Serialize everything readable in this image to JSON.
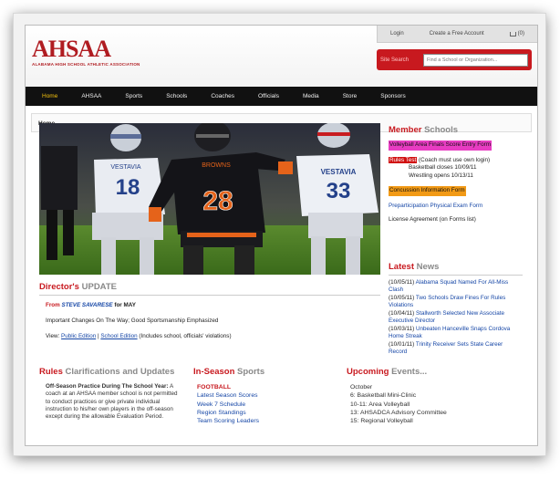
{
  "header": {
    "logo_text": "AHSAA",
    "logo_subtitle": "ALABAMA HIGH SCHOOL ATHLETIC ASSOCIATION",
    "login": "Login",
    "create_account": "Create a Free Account",
    "cart": "(0)",
    "search_label": "Site Search",
    "search_placeholder": "Find a School or Organization..."
  },
  "nav": [
    "Home",
    "AHSAA",
    "Sports",
    "Schools",
    "Coaches",
    "Officials",
    "Media",
    "Store",
    "Sponsors"
  ],
  "breadcrumb": "Home",
  "member": {
    "title_a": "Member",
    "title_b": "Schools",
    "volleyball": "Volleyball Area Finals Score Entry Form",
    "rules_test": "Rules Test",
    "rules_note": "(Coach must use own login)",
    "basketball_closes": "Basketball closes 10/09/11",
    "wrestling_opens": "Wrestling opens 10/13/11",
    "concussion": "Concussion Information Form",
    "preparticipation": "Preparticipation Physical Exam Form",
    "license": "License Agreement (on Forms list)"
  },
  "latest": {
    "title_a": "Latest",
    "title_b": "News",
    "items": [
      {
        "date": "(10/05/11)",
        "text": "Alabama Squad Named For All-Miss Clash"
      },
      {
        "date": "(10/05/11)",
        "text": "Two Schools Draw Fines For Rules Violations"
      },
      {
        "date": "(10/04/11)",
        "text": "Stallworth Selected New Associate Executive Director"
      },
      {
        "date": "(10/03/11)",
        "text": "Unbeaten Hanceville Snaps Cordova Home Streak"
      },
      {
        "date": "(10/01/11)",
        "text": "Trinity Receiver Sets State Career Record"
      }
    ]
  },
  "director": {
    "title_a": "Director's",
    "title_b": "UPDATE",
    "from": "From",
    "name": "STEVE SAVARESE",
    "for_may": "for MAY",
    "headline": "Important Changes On The Way; Good Sportsmanship Emphasized",
    "view": "View:",
    "public_edition": "Public Edition",
    "separator": "|",
    "school_edition": "School Edition",
    "school_note": "(Includes school, officials' violations)"
  },
  "rules": {
    "title_a": "Rules",
    "title_b": "Clarifications and Updates",
    "heading": "Off-Season Practice During The School Year:",
    "body": "A coach at an AHSAA member school is not permitted to conduct practices or give private individual instruction to his/her own players in the off-season except during the allowable Evaluation Period."
  },
  "season": {
    "title_a": "In-Season",
    "title_b": "Sports",
    "sport": "FOOTBALL",
    "links": [
      "Latest Season Scores",
      "Week 7 Schedule",
      "Region Standings",
      "Team Scoring Leaders"
    ]
  },
  "events": {
    "title_a": "Upcoming",
    "title_b": "Events...",
    "month": "October",
    "items": [
      "6: Basketball Mini-Clinic",
      "10-11: Area Volleyball",
      "13: AHSADCA Advisory Committee",
      "15: Regional Volleyball"
    ]
  },
  "hero": {
    "jersey_left": "18",
    "jersey_center": "28",
    "jersey_right": "33",
    "team_left": "VESTAVIA",
    "team_center": "BROWNS",
    "team_right": "VESTAVIA"
  },
  "colors": {
    "brand_red": "#c8191f",
    "nav_bg": "#111111",
    "nav_active": "#f3c10e",
    "link_blue": "#1546a6"
  }
}
